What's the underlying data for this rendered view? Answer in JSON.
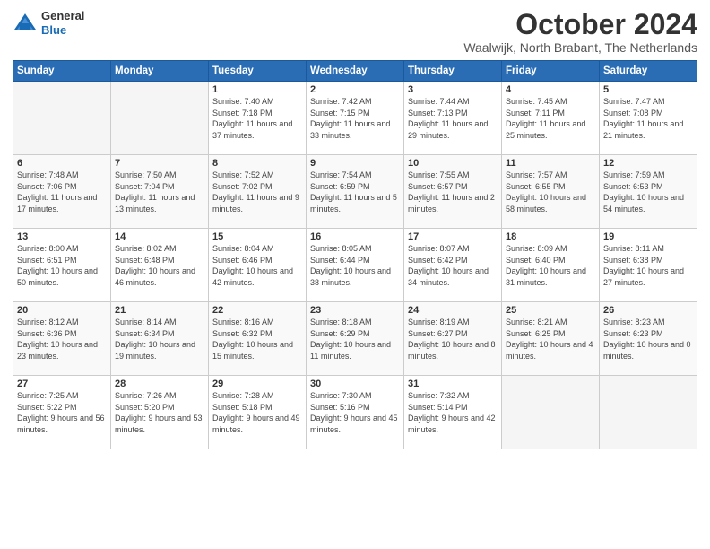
{
  "header": {
    "logo_general": "General",
    "logo_blue": "Blue",
    "month": "October 2024",
    "location": "Waalwijk, North Brabant, The Netherlands"
  },
  "weekdays": [
    "Sunday",
    "Monday",
    "Tuesday",
    "Wednesday",
    "Thursday",
    "Friday",
    "Saturday"
  ],
  "weeks": [
    [
      {
        "day": "",
        "sunrise": "",
        "sunset": "",
        "daylight": "",
        "empty": true
      },
      {
        "day": "",
        "sunrise": "",
        "sunset": "",
        "daylight": "",
        "empty": true
      },
      {
        "day": "1",
        "sunrise": "Sunrise: 7:40 AM",
        "sunset": "Sunset: 7:18 PM",
        "daylight": "Daylight: 11 hours and 37 minutes.",
        "empty": false
      },
      {
        "day": "2",
        "sunrise": "Sunrise: 7:42 AM",
        "sunset": "Sunset: 7:15 PM",
        "daylight": "Daylight: 11 hours and 33 minutes.",
        "empty": false
      },
      {
        "day": "3",
        "sunrise": "Sunrise: 7:44 AM",
        "sunset": "Sunset: 7:13 PM",
        "daylight": "Daylight: 11 hours and 29 minutes.",
        "empty": false
      },
      {
        "day": "4",
        "sunrise": "Sunrise: 7:45 AM",
        "sunset": "Sunset: 7:11 PM",
        "daylight": "Daylight: 11 hours and 25 minutes.",
        "empty": false
      },
      {
        "day": "5",
        "sunrise": "Sunrise: 7:47 AM",
        "sunset": "Sunset: 7:08 PM",
        "daylight": "Daylight: 11 hours and 21 minutes.",
        "empty": false
      }
    ],
    [
      {
        "day": "6",
        "sunrise": "Sunrise: 7:48 AM",
        "sunset": "Sunset: 7:06 PM",
        "daylight": "Daylight: 11 hours and 17 minutes.",
        "empty": false
      },
      {
        "day": "7",
        "sunrise": "Sunrise: 7:50 AM",
        "sunset": "Sunset: 7:04 PM",
        "daylight": "Daylight: 11 hours and 13 minutes.",
        "empty": false
      },
      {
        "day": "8",
        "sunrise": "Sunrise: 7:52 AM",
        "sunset": "Sunset: 7:02 PM",
        "daylight": "Daylight: 11 hours and 9 minutes.",
        "empty": false
      },
      {
        "day": "9",
        "sunrise": "Sunrise: 7:54 AM",
        "sunset": "Sunset: 6:59 PM",
        "daylight": "Daylight: 11 hours and 5 minutes.",
        "empty": false
      },
      {
        "day": "10",
        "sunrise": "Sunrise: 7:55 AM",
        "sunset": "Sunset: 6:57 PM",
        "daylight": "Daylight: 11 hours and 2 minutes.",
        "empty": false
      },
      {
        "day": "11",
        "sunrise": "Sunrise: 7:57 AM",
        "sunset": "Sunset: 6:55 PM",
        "daylight": "Daylight: 10 hours and 58 minutes.",
        "empty": false
      },
      {
        "day": "12",
        "sunrise": "Sunrise: 7:59 AM",
        "sunset": "Sunset: 6:53 PM",
        "daylight": "Daylight: 10 hours and 54 minutes.",
        "empty": false
      }
    ],
    [
      {
        "day": "13",
        "sunrise": "Sunrise: 8:00 AM",
        "sunset": "Sunset: 6:51 PM",
        "daylight": "Daylight: 10 hours and 50 minutes.",
        "empty": false
      },
      {
        "day": "14",
        "sunrise": "Sunrise: 8:02 AM",
        "sunset": "Sunset: 6:48 PM",
        "daylight": "Daylight: 10 hours and 46 minutes.",
        "empty": false
      },
      {
        "day": "15",
        "sunrise": "Sunrise: 8:04 AM",
        "sunset": "Sunset: 6:46 PM",
        "daylight": "Daylight: 10 hours and 42 minutes.",
        "empty": false
      },
      {
        "day": "16",
        "sunrise": "Sunrise: 8:05 AM",
        "sunset": "Sunset: 6:44 PM",
        "daylight": "Daylight: 10 hours and 38 minutes.",
        "empty": false
      },
      {
        "day": "17",
        "sunrise": "Sunrise: 8:07 AM",
        "sunset": "Sunset: 6:42 PM",
        "daylight": "Daylight: 10 hours and 34 minutes.",
        "empty": false
      },
      {
        "day": "18",
        "sunrise": "Sunrise: 8:09 AM",
        "sunset": "Sunset: 6:40 PM",
        "daylight": "Daylight: 10 hours and 31 minutes.",
        "empty": false
      },
      {
        "day": "19",
        "sunrise": "Sunrise: 8:11 AM",
        "sunset": "Sunset: 6:38 PM",
        "daylight": "Daylight: 10 hours and 27 minutes.",
        "empty": false
      }
    ],
    [
      {
        "day": "20",
        "sunrise": "Sunrise: 8:12 AM",
        "sunset": "Sunset: 6:36 PM",
        "daylight": "Daylight: 10 hours and 23 minutes.",
        "empty": false
      },
      {
        "day": "21",
        "sunrise": "Sunrise: 8:14 AM",
        "sunset": "Sunset: 6:34 PM",
        "daylight": "Daylight: 10 hours and 19 minutes.",
        "empty": false
      },
      {
        "day": "22",
        "sunrise": "Sunrise: 8:16 AM",
        "sunset": "Sunset: 6:32 PM",
        "daylight": "Daylight: 10 hours and 15 minutes.",
        "empty": false
      },
      {
        "day": "23",
        "sunrise": "Sunrise: 8:18 AM",
        "sunset": "Sunset: 6:29 PM",
        "daylight": "Daylight: 10 hours and 11 minutes.",
        "empty": false
      },
      {
        "day": "24",
        "sunrise": "Sunrise: 8:19 AM",
        "sunset": "Sunset: 6:27 PM",
        "daylight": "Daylight: 10 hours and 8 minutes.",
        "empty": false
      },
      {
        "day": "25",
        "sunrise": "Sunrise: 8:21 AM",
        "sunset": "Sunset: 6:25 PM",
        "daylight": "Daylight: 10 hours and 4 minutes.",
        "empty": false
      },
      {
        "day": "26",
        "sunrise": "Sunrise: 8:23 AM",
        "sunset": "Sunset: 6:23 PM",
        "daylight": "Daylight: 10 hours and 0 minutes.",
        "empty": false
      }
    ],
    [
      {
        "day": "27",
        "sunrise": "Sunrise: 7:25 AM",
        "sunset": "Sunset: 5:22 PM",
        "daylight": "Daylight: 9 hours and 56 minutes.",
        "empty": false
      },
      {
        "day": "28",
        "sunrise": "Sunrise: 7:26 AM",
        "sunset": "Sunset: 5:20 PM",
        "daylight": "Daylight: 9 hours and 53 minutes.",
        "empty": false
      },
      {
        "day": "29",
        "sunrise": "Sunrise: 7:28 AM",
        "sunset": "Sunset: 5:18 PM",
        "daylight": "Daylight: 9 hours and 49 minutes.",
        "empty": false
      },
      {
        "day": "30",
        "sunrise": "Sunrise: 7:30 AM",
        "sunset": "Sunset: 5:16 PM",
        "daylight": "Daylight: 9 hours and 45 minutes.",
        "empty": false
      },
      {
        "day": "31",
        "sunrise": "Sunrise: 7:32 AM",
        "sunset": "Sunset: 5:14 PM",
        "daylight": "Daylight: 9 hours and 42 minutes.",
        "empty": false
      },
      {
        "day": "",
        "sunrise": "",
        "sunset": "",
        "daylight": "",
        "empty": true
      },
      {
        "day": "",
        "sunrise": "",
        "sunset": "",
        "daylight": "",
        "empty": true
      }
    ]
  ]
}
